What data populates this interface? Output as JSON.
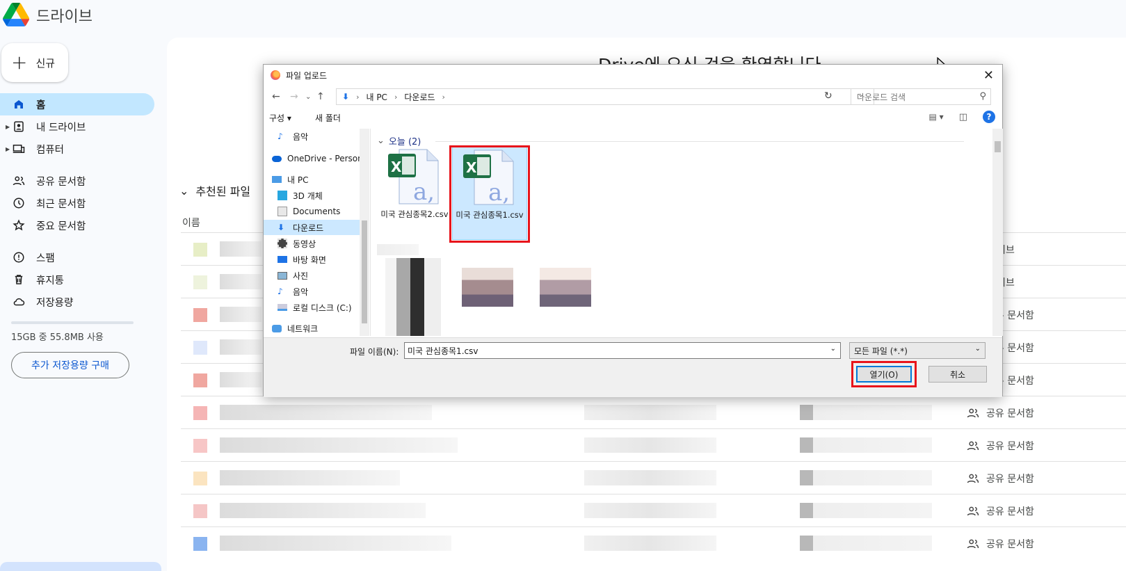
{
  "drive": {
    "app_title": "드라이브",
    "new_label": "신규",
    "nav": {
      "home": "홈",
      "my_drive": "내 드라이브",
      "computers": "컴퓨터",
      "shared": "공유 문서함",
      "recent": "최근 문서함",
      "starred": "중요 문서함",
      "spam": "스팸",
      "trash": "휴지통",
      "storage": "저장용량"
    },
    "storage_text": "15GB 중 55.8MB 사용",
    "buy_storage": "추가 저장용량 구매",
    "welcome": "Drive에 오신 것을 환영합니다",
    "recommended_header": "추천된 파일",
    "col_name": "이름",
    "row_locations": [
      "내 드라이브",
      "내 드라이브",
      "공유 문서함",
      "공유 문서함",
      "공유 문서함",
      "공유 문서함",
      "공유 문서함",
      "공유 문서함",
      "공유 문서함",
      "공유 문서함"
    ]
  },
  "dialog": {
    "title": "파일 업로드",
    "breadcrumb": [
      "내 PC",
      "다운로드"
    ],
    "search_placeholder": "다운로드 검색",
    "organize": "구성",
    "new_folder": "새 폴더",
    "tree": [
      "음악",
      "OneDrive - Person",
      "내 PC",
      "3D 개체",
      "Documents",
      "다운로드",
      "동영상",
      "바탕 화면",
      "사진",
      "음악",
      "로컬 디스크 (C:)",
      "네트워크"
    ],
    "group_label": "오늘 (2)",
    "files": [
      {
        "name": "미국 관심종목2.csv",
        "selected": false
      },
      {
        "name": "미국 관심종목1.csv",
        "selected": true
      }
    ],
    "filename_label": "파일 이름(N):",
    "filename_value": "미국 관심종목1.csv",
    "filetype": "모든 파일 (*.*)",
    "open_label": "열기(O)",
    "cancel_label": "취소"
  },
  "colors": {
    "drive_active_bg": "#c2e7ff",
    "accent_blue": "#0b57d0",
    "highlight_red": "#e8141b",
    "selection_blue": "#cce8ff"
  }
}
